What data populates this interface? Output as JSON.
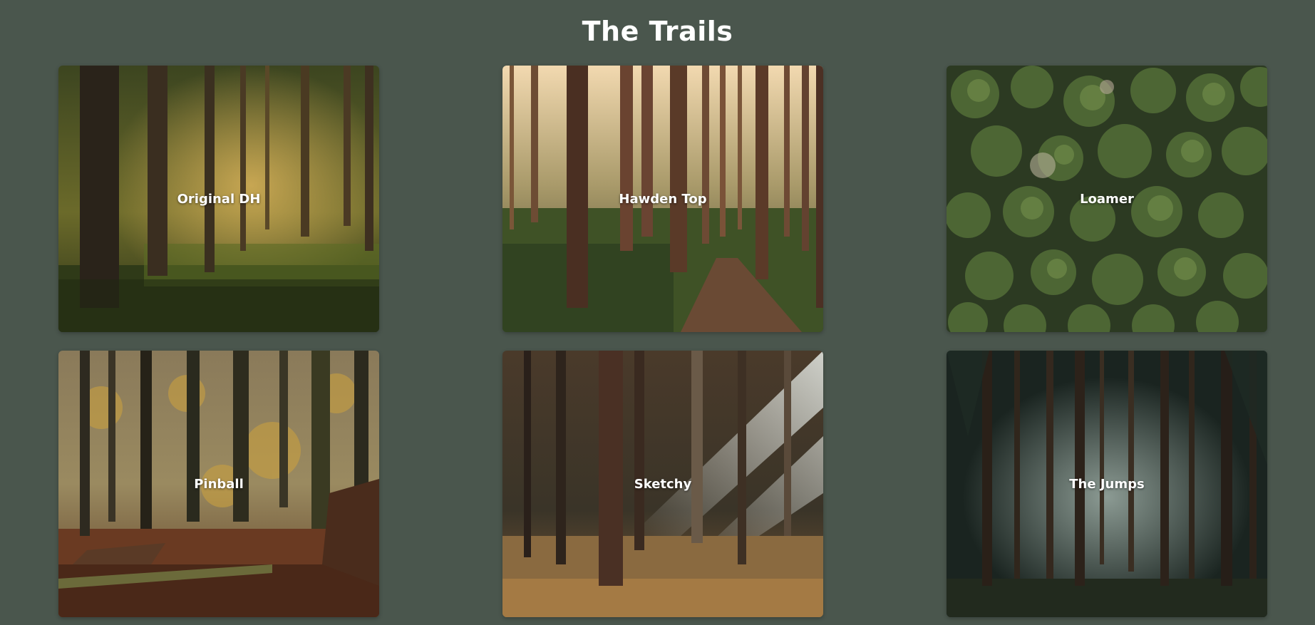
{
  "page": {
    "title": "The Trails",
    "background_color": "#4a564d"
  },
  "trails": [
    {
      "name": "Original DH",
      "image": "sunlit-forest-photo"
    },
    {
      "name": "Hawden Top",
      "image": "tall-trees-path-photo"
    },
    {
      "name": "Loamer",
      "image": "aerial-treetops-photo"
    },
    {
      "name": "Pinball",
      "image": "autumn-forest-photo"
    },
    {
      "name": "Sketchy",
      "image": "sunbeam-forest-photo"
    },
    {
      "name": "The Jumps",
      "image": "misty-dark-forest-photo"
    }
  ]
}
